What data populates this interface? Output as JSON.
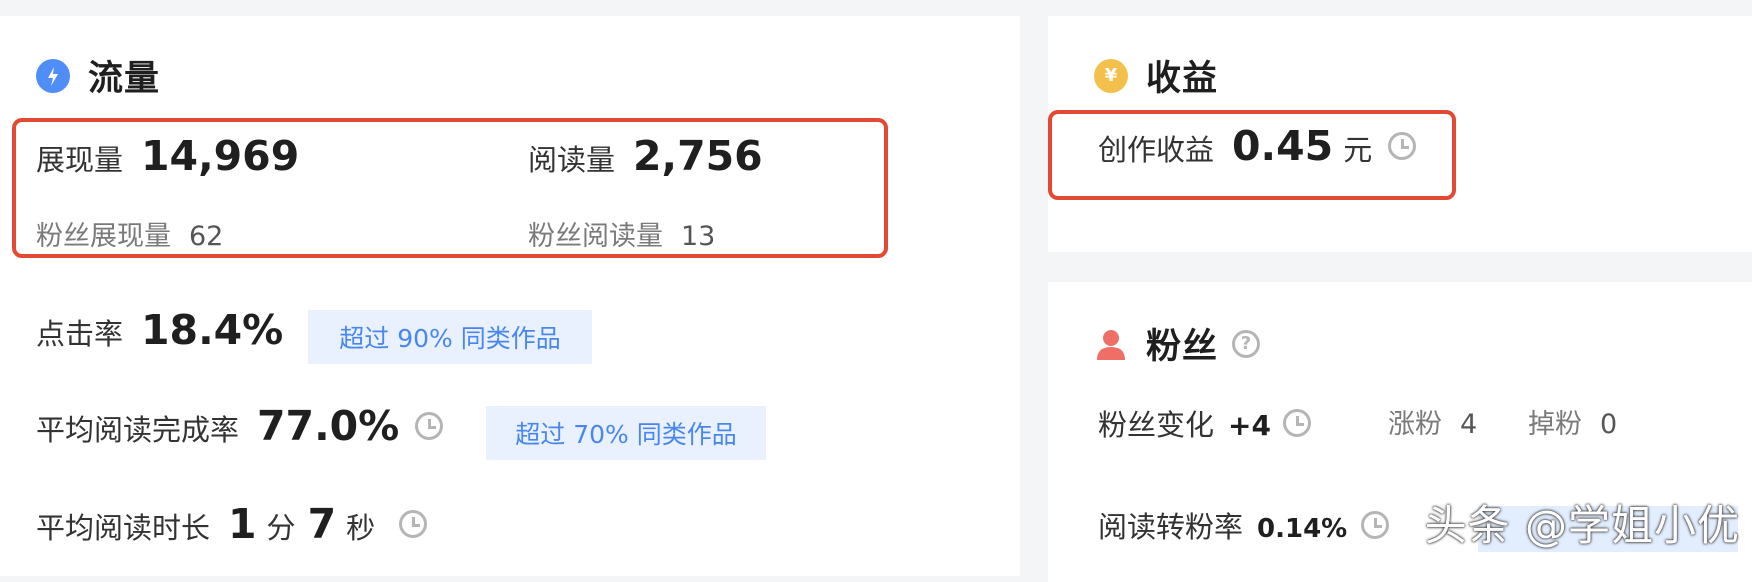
{
  "traffic": {
    "title": "流量",
    "impressions_label": "展现量",
    "impressions_value": "14,969",
    "reads_label": "阅读量",
    "reads_value": "2,756",
    "fan_impressions_label": "粉丝展现量",
    "fan_impressions_value": "62",
    "fan_reads_label": "粉丝阅读量",
    "fan_reads_value": "13",
    "ctr_label": "点击率",
    "ctr_value": "18.4%",
    "ctr_badge": "超过 90% 同类作品",
    "completion_label": "平均阅读完成率",
    "completion_value": "77.0%",
    "completion_badge": "超过 70% 同类作品",
    "duration_label": "平均阅读时长",
    "duration_min": "1",
    "duration_min_unit": "分",
    "duration_sec": "7",
    "duration_sec_unit": "秒"
  },
  "income": {
    "title": "收益",
    "coin_symbol": "¥",
    "creation_label": "创作收益",
    "creation_value": "0.45",
    "creation_unit": "元"
  },
  "fans": {
    "title": "粉丝",
    "change_label": "粉丝变化",
    "change_value": "+4",
    "gain_label": "涨粉",
    "gain_value": "4",
    "loss_label": "掉粉",
    "loss_value": "0",
    "conversion_label": "阅读转粉率",
    "conversion_value": "0.14%"
  },
  "watermark": "头条 @学姐小优",
  "colors": {
    "highlight": "#e24a33",
    "accent_blue": "#4a86f0",
    "badge_bg": "#e9f1fe",
    "coin": "#f3c14b",
    "fan_icon": "#ef6e65"
  }
}
